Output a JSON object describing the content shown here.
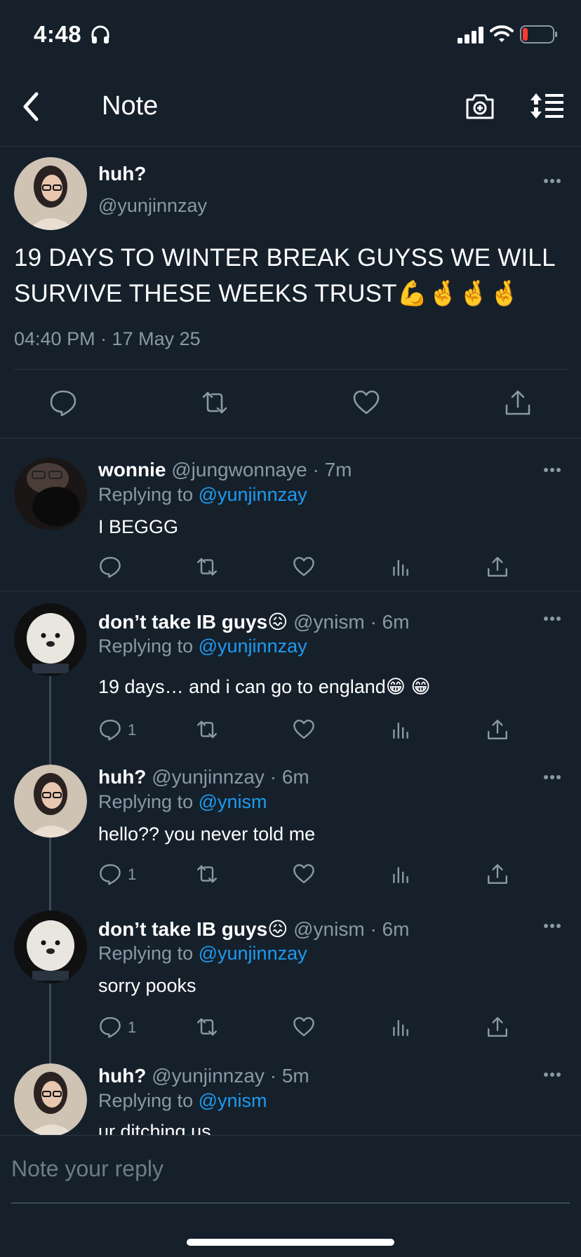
{
  "status_bar": {
    "time": "4:48"
  },
  "header": {
    "title": "Note"
  },
  "main_note": {
    "name": "huh?",
    "handle": "@yunjinnzay",
    "text_line1": "19 DAYS TO WINTER BREAK GUYSS WE WILL",
    "text_line2": "SURVIVE THESE WEEKS TRUST💪🤞🤞🤞",
    "timestamp": "04:40 PM · 17 May 25"
  },
  "replies": [
    {
      "name": "wonnie",
      "handle": "@jungwonnaye",
      "time": "· 7m",
      "replying_prefix": "Replying to",
      "replying_to": "@yunjinnzay",
      "text": "I BEGGG",
      "reply_count": ""
    },
    {
      "name": "don’t take IB guys😖",
      "handle": "@ynism",
      "time": "· 6m",
      "replying_prefix": "Replying to",
      "replying_to": "@yunjinnzay",
      "text": "19 days… and i can go to england😁 😁",
      "reply_count": "1"
    },
    {
      "name": "huh?",
      "handle": "@yunjinnzay",
      "time": "· 6m",
      "replying_prefix": "Replying to",
      "replying_to": "@ynism",
      "text": "hello?? you never told me",
      "reply_count": "1"
    },
    {
      "name": "don’t take IB guys😖",
      "handle": "@ynism",
      "time": "· 6m",
      "replying_prefix": "Replying to",
      "replying_to": "@yunjinnzay",
      "text": "sorry pooks",
      "reply_count": "1"
    },
    {
      "name": "huh?",
      "handle": "@yunjinnzay",
      "time": "· 5m",
      "replying_prefix": "Replying to",
      "replying_to": "@ynism",
      "text": "ur ditching us",
      "reply_count": ""
    }
  ],
  "compose": {
    "placeholder": "Note your reply"
  },
  "colors": {
    "background": "#15202b",
    "accent": "#1d9bf0",
    "muted": "#8b98a5",
    "battery_low": "#ff3b30"
  },
  "icons": [
    "headphones-icon",
    "signal-icon",
    "wifi-icon",
    "battery-icon",
    "back-arrow-icon",
    "camera-add-icon",
    "sort-icon",
    "more-icon",
    "comment-icon",
    "retweet-icon",
    "heart-icon",
    "share-icon",
    "analytics-icon"
  ]
}
